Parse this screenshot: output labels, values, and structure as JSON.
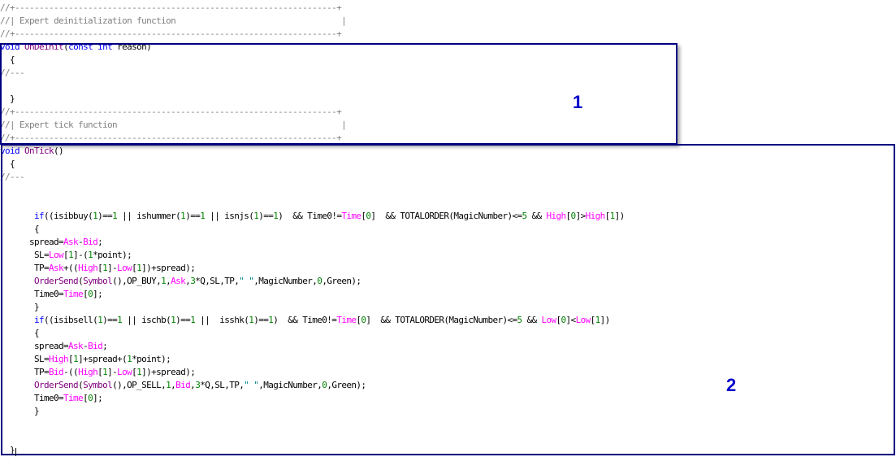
{
  "editor": {
    "lines": [
      [
        [
          "cmt",
          "//+------------------------------------------------------------------+"
        ]
      ],
      [
        [
          "cmt",
          "//| Expert deinitialization function                                  |"
        ]
      ],
      [
        [
          "cmt",
          "//+------------------------------------------------------------------+"
        ]
      ],
      [
        [
          "kw",
          "void"
        ],
        [
          "pl",
          " "
        ],
        [
          "fn",
          "OnDeinit"
        ],
        [
          "pl",
          "("
        ],
        [
          "kw",
          "const"
        ],
        [
          "pl",
          " "
        ],
        [
          "kw",
          "int"
        ],
        [
          "pl",
          " reason)"
        ]
      ],
      [
        [
          "pl",
          "  {"
        ]
      ],
      [
        [
          "cmt",
          "//---"
        ]
      ],
      [
        [
          "pl",
          ""
        ]
      ],
      [
        [
          "pl",
          "  }"
        ]
      ],
      [
        [
          "cmt",
          "//+------------------------------------------------------------------+"
        ]
      ],
      [
        [
          "cmt",
          "//| Expert tick function                                              |"
        ]
      ],
      [
        [
          "cmt",
          "//+------------------------------------------------------------------+"
        ]
      ],
      [
        [
          "kw",
          "void"
        ],
        [
          "pl",
          " "
        ],
        [
          "fn",
          "OnTick"
        ],
        [
          "pl",
          "()"
        ]
      ],
      [
        [
          "pl",
          "  {"
        ]
      ],
      [
        [
          "cmt",
          "//---"
        ]
      ],
      [
        [
          "pl",
          ""
        ]
      ],
      [
        [
          "pl",
          ""
        ]
      ],
      [
        [
          "pl",
          "       "
        ],
        [
          "kw",
          "if"
        ],
        [
          "pl",
          "((isibbuy("
        ],
        [
          "num",
          "1"
        ],
        [
          "pl",
          ")=="
        ],
        [
          "num",
          "1"
        ],
        [
          "pl",
          " || ishummer("
        ],
        [
          "num",
          "1"
        ],
        [
          "pl",
          ")=="
        ],
        [
          "num",
          "1"
        ],
        [
          "pl",
          " || isnjs("
        ],
        [
          "num",
          "1"
        ],
        [
          "pl",
          ")=="
        ],
        [
          "num",
          "1"
        ],
        [
          "pl",
          ")  && Time0!="
        ],
        [
          "pre",
          "Time"
        ],
        [
          "pl",
          "["
        ],
        [
          "num",
          "0"
        ],
        [
          "pl",
          "]  && TOTALORDER(MagicNumber)<="
        ],
        [
          "num",
          "5"
        ],
        [
          "pl",
          " && "
        ],
        [
          "pre",
          "High"
        ],
        [
          "pl",
          "["
        ],
        [
          "num",
          "0"
        ],
        [
          "pl",
          "]>"
        ],
        [
          "pre",
          "High"
        ],
        [
          "pl",
          "["
        ],
        [
          "num",
          "1"
        ],
        [
          "pl",
          "])"
        ]
      ],
      [
        [
          "pl",
          "       {"
        ]
      ],
      [
        [
          "pl",
          "      spread="
        ],
        [
          "pre",
          "Ask"
        ],
        [
          "pl",
          "-"
        ],
        [
          "pre",
          "Bid"
        ],
        [
          "pl",
          ";"
        ]
      ],
      [
        [
          "pl",
          "       SL="
        ],
        [
          "pre",
          "Low"
        ],
        [
          "pl",
          "["
        ],
        [
          "num",
          "1"
        ],
        [
          "pl",
          "]-("
        ],
        [
          "num",
          "1"
        ],
        [
          "pl",
          "*point);"
        ]
      ],
      [
        [
          "pl",
          "       TP="
        ],
        [
          "pre",
          "Ask"
        ],
        [
          "pl",
          "+(("
        ],
        [
          "pre",
          "High"
        ],
        [
          "pl",
          "["
        ],
        [
          "num",
          "1"
        ],
        [
          "pl",
          "]-"
        ],
        [
          "pre",
          "Low"
        ],
        [
          "pl",
          "["
        ],
        [
          "num",
          "1"
        ],
        [
          "pl",
          "])+spread);"
        ]
      ],
      [
        [
          "pl",
          "       "
        ],
        [
          "fn",
          "OrderSend"
        ],
        [
          "pl",
          "("
        ],
        [
          "fn",
          "Symbol"
        ],
        [
          "pl",
          "(),OP_BUY,"
        ],
        [
          "num",
          "1"
        ],
        [
          "pl",
          ","
        ],
        [
          "pre",
          "Ask"
        ],
        [
          "pl",
          ","
        ],
        [
          "num",
          "3"
        ],
        [
          "pl",
          "*Q,SL,TP,"
        ],
        [
          "str",
          "\" \""
        ],
        [
          "pl",
          ",MagicNumber,"
        ],
        [
          "num",
          "0"
        ],
        [
          "pl",
          ",Green);"
        ]
      ],
      [
        [
          "pl",
          "       Time0="
        ],
        [
          "pre",
          "Time"
        ],
        [
          "pl",
          "["
        ],
        [
          "num",
          "0"
        ],
        [
          "pl",
          "];"
        ]
      ],
      [
        [
          "pl",
          "       }"
        ]
      ],
      [
        [
          "pl",
          "       "
        ],
        [
          "kw",
          "if"
        ],
        [
          "pl",
          "((isibsell("
        ],
        [
          "num",
          "1"
        ],
        [
          "pl",
          ")=="
        ],
        [
          "num",
          "1"
        ],
        [
          "pl",
          " || ischb("
        ],
        [
          "num",
          "1"
        ],
        [
          "pl",
          ")=="
        ],
        [
          "num",
          "1"
        ],
        [
          "pl",
          " ||  isshk("
        ],
        [
          "num",
          "1"
        ],
        [
          "pl",
          ")=="
        ],
        [
          "num",
          "1"
        ],
        [
          "pl",
          ")  && Time0!="
        ],
        [
          "pre",
          "Time"
        ],
        [
          "pl",
          "["
        ],
        [
          "num",
          "0"
        ],
        [
          "pl",
          "]  && TOTALORDER(MagicNumber)<="
        ],
        [
          "num",
          "5"
        ],
        [
          "pl",
          " && "
        ],
        [
          "pre",
          "Low"
        ],
        [
          "pl",
          "["
        ],
        [
          "num",
          "0"
        ],
        [
          "pl",
          "]<"
        ],
        [
          "pre",
          "Low"
        ],
        [
          "pl",
          "["
        ],
        [
          "num",
          "1"
        ],
        [
          "pl",
          "])"
        ]
      ],
      [
        [
          "pl",
          "       {"
        ]
      ],
      [
        [
          "pl",
          "       spread="
        ],
        [
          "pre",
          "Ask"
        ],
        [
          "pl",
          "-"
        ],
        [
          "pre",
          "Bid"
        ],
        [
          "pl",
          ";"
        ]
      ],
      [
        [
          "pl",
          "       SL="
        ],
        [
          "pre",
          "High"
        ],
        [
          "pl",
          "["
        ],
        [
          "num",
          "1"
        ],
        [
          "pl",
          "]+spread+("
        ],
        [
          "num",
          "1"
        ],
        [
          "pl",
          "*point);"
        ]
      ],
      [
        [
          "pl",
          "       TP="
        ],
        [
          "pre",
          "Bid"
        ],
        [
          "pl",
          "-(("
        ],
        [
          "pre",
          "High"
        ],
        [
          "pl",
          "["
        ],
        [
          "num",
          "1"
        ],
        [
          "pl",
          "]-"
        ],
        [
          "pre",
          "Low"
        ],
        [
          "pl",
          "["
        ],
        [
          "num",
          "1"
        ],
        [
          "pl",
          "])+spread);"
        ]
      ],
      [
        [
          "pl",
          "       "
        ],
        [
          "fn",
          "OrderSend"
        ],
        [
          "pl",
          "("
        ],
        [
          "fn",
          "Symbol"
        ],
        [
          "pl",
          "(),OP_SELL,"
        ],
        [
          "num",
          "1"
        ],
        [
          "pl",
          ","
        ],
        [
          "pre",
          "Bid"
        ],
        [
          "pl",
          ","
        ],
        [
          "num",
          "3"
        ],
        [
          "pl",
          "*Q,SL,TP,"
        ],
        [
          "str",
          "\" \""
        ],
        [
          "pl",
          ",MagicNumber,"
        ],
        [
          "num",
          "0"
        ],
        [
          "pl",
          ",Green);"
        ]
      ],
      [
        [
          "pl",
          "       Time0="
        ],
        [
          "pre",
          "Time"
        ],
        [
          "pl",
          "["
        ],
        [
          "num",
          "0"
        ],
        [
          "pl",
          "];"
        ]
      ],
      [
        [
          "pl",
          "       }"
        ]
      ],
      [
        [
          "pl",
          ""
        ]
      ],
      [
        [
          "pl",
          ""
        ]
      ],
      [
        [
          "pl",
          "  }"
        ]
      ]
    ]
  },
  "annotations": {
    "box1_label": "1",
    "box2_label": "2",
    "box_color": "#00007f"
  },
  "colors": {
    "comment": "#808080",
    "keyword": "#0000ff",
    "function": "#800080",
    "predefined": "#ff00ff",
    "number": "#008000",
    "string": "#008080"
  }
}
